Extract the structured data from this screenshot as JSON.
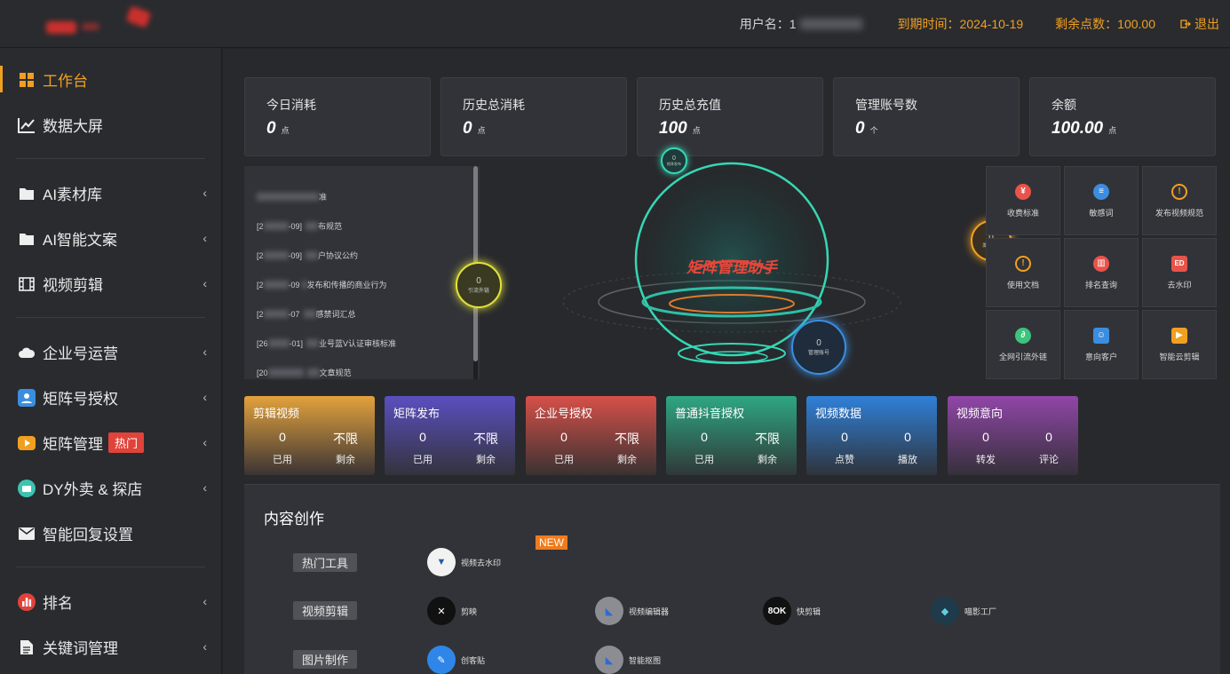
{
  "header": {
    "user_label": "用户名：1",
    "expire": "到期时间：2024-10-19",
    "points": "剩余点数：100.00",
    "logout": "退出"
  },
  "sidebar": {
    "items": [
      {
        "label": "工作台",
        "icon": "windows-icon"
      },
      {
        "label": "数据大屏",
        "icon": "chart-line-icon"
      },
      {
        "label": "AI素材库",
        "icon": "folder-icon"
      },
      {
        "label": "AI智能文案",
        "icon": "folder-icon"
      },
      {
        "label": "视频剪辑",
        "icon": "film-icon"
      },
      {
        "label": "企业号运营",
        "icon": "cloud-icon"
      },
      {
        "label": "矩阵号授权",
        "icon": "user-badge-icon"
      },
      {
        "label": "矩阵管理",
        "icon": "video-icon",
        "badge": "热门"
      },
      {
        "label": "DY外卖 & 探店",
        "icon": "shop-icon"
      },
      {
        "label": "智能回复设置",
        "icon": "mail-icon"
      },
      {
        "label": "排名",
        "icon": "rank-icon"
      },
      {
        "label": "关键词管理",
        "icon": "document-icon"
      }
    ]
  },
  "stats": [
    {
      "title": "今日消耗",
      "value": "0",
      "unit": "点"
    },
    {
      "title": "历史总消耗",
      "value": "0",
      "unit": "点"
    },
    {
      "title": "历史总充值",
      "value": "100",
      "unit": "点"
    },
    {
      "title": "管理账号数",
      "value": "0",
      "unit": "个"
    },
    {
      "title": "余额",
      "value": "100.00",
      "unit": "点"
    }
  ],
  "notices": [
    {
      "date": "",
      "text": "准"
    },
    {
      "date": "[2",
      "date_end": "-09]",
      "text": "布规范"
    },
    {
      "date": "[2",
      "date_end": "-09]",
      "text": "户协议公约"
    },
    {
      "date": "[2",
      "date_end": "-09",
      "text": "发布和传播的商业行为"
    },
    {
      "date": "[2",
      "date_end": "-07",
      "text": "感禁词汇总"
    },
    {
      "date": "[26",
      "date_end": "-01]",
      "text": "业号蓝V认证审核标准"
    },
    {
      "date": "[20",
      "date_end": "",
      "text": "文章规范"
    }
  ],
  "hub": {
    "title": "矩阵管理助手",
    "rings": [
      {
        "value": "0",
        "label": "矩阵发布"
      },
      {
        "value": "0",
        "label": "引流外链"
      },
      {
        "value": "0",
        "label": "管理账号"
      },
      {
        "value": "0",
        "label": "发布视频"
      }
    ]
  },
  "tools": [
    {
      "label": "收费标准",
      "color": "#e8534a"
    },
    {
      "label": "敏感词",
      "color": "#3b8de0"
    },
    {
      "label": "发布视频规范",
      "color": "#f0a020"
    },
    {
      "label": "使用文档",
      "color": "#f0a020"
    },
    {
      "label": "排名查询",
      "color": "#e8534a"
    },
    {
      "label": "去水印",
      "color": "#e8534a"
    },
    {
      "label": "全网引流外链",
      "color": "#3cc47c"
    },
    {
      "label": "意向客户",
      "color": "#3b8de0"
    },
    {
      "label": "智能云剪辑",
      "color": "#f0a020"
    }
  ],
  "cards": [
    {
      "title": "剪辑视频",
      "v1": "0",
      "l1": "已用",
      "v2": "不限",
      "l2": "剩余",
      "color_top": "#e3a23c",
      "color_bottom": "#3a3434"
    },
    {
      "title": "矩阵发布",
      "v1": "0",
      "l1": "已用",
      "v2": "不限",
      "l2": "剩余",
      "color_top": "#5a4fc0",
      "color_bottom": "#33333c"
    },
    {
      "title": "企业号授权",
      "v1": "0",
      "l1": "已用",
      "v2": "不限",
      "l2": "剩余",
      "color_top": "#d65049",
      "color_bottom": "#3a3232"
    },
    {
      "title": "普通抖音授权",
      "v1": "0",
      "l1": "已用",
      "v2": "不限",
      "l2": "剩余",
      "color_top": "#2ea783",
      "color_bottom": "#2f3836"
    },
    {
      "title": "视频数据",
      "v1": "0",
      "l1": "点赞",
      "v2": "0",
      "l2": "播放",
      "color_top": "#2f80d8",
      "color_bottom": "#2f343c"
    },
    {
      "title": "视频意向",
      "v1": "0",
      "l1": "转发",
      "v2": "0",
      "l2": "评论",
      "color_top": "#9146a8",
      "color_bottom": "#35303a"
    }
  ],
  "content": {
    "heading": "内容创作",
    "rows": [
      {
        "tag": "热门工具",
        "apps": [
          {
            "name": "视频去水印",
            "new": "NEW"
          }
        ]
      },
      {
        "tag": "视频剪辑",
        "apps": [
          {
            "name": "剪映"
          },
          {
            "name": "视频编辑器"
          },
          {
            "name": "快剪辑"
          },
          {
            "name": "喵影工厂"
          }
        ]
      },
      {
        "tag": "图片制作",
        "apps": [
          {
            "name": "创客贴"
          },
          {
            "name": "智能抠图"
          }
        ]
      }
    ]
  }
}
